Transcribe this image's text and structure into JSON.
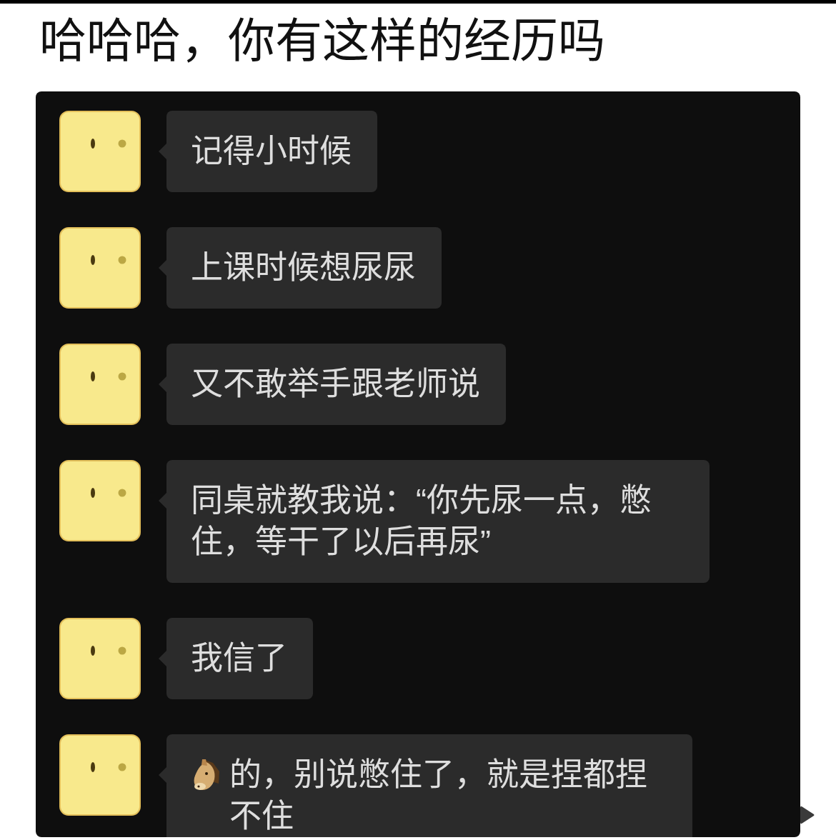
{
  "title": "哈哈哈，你有这样的经历吗",
  "messages": [
    {
      "kind": "text",
      "text": "记得小时候"
    },
    {
      "kind": "text",
      "text": "上课时候想尿尿"
    },
    {
      "kind": "text",
      "text": "又不敢举手跟老师说"
    },
    {
      "kind": "text",
      "text": "同桌就教我说：“你先尿一点，憋住，等干了以后再尿”"
    },
    {
      "kind": "text",
      "text": "我信了"
    },
    {
      "kind": "icon_text",
      "text": "的，别说憋住了，就是捏都捏不住"
    }
  ]
}
